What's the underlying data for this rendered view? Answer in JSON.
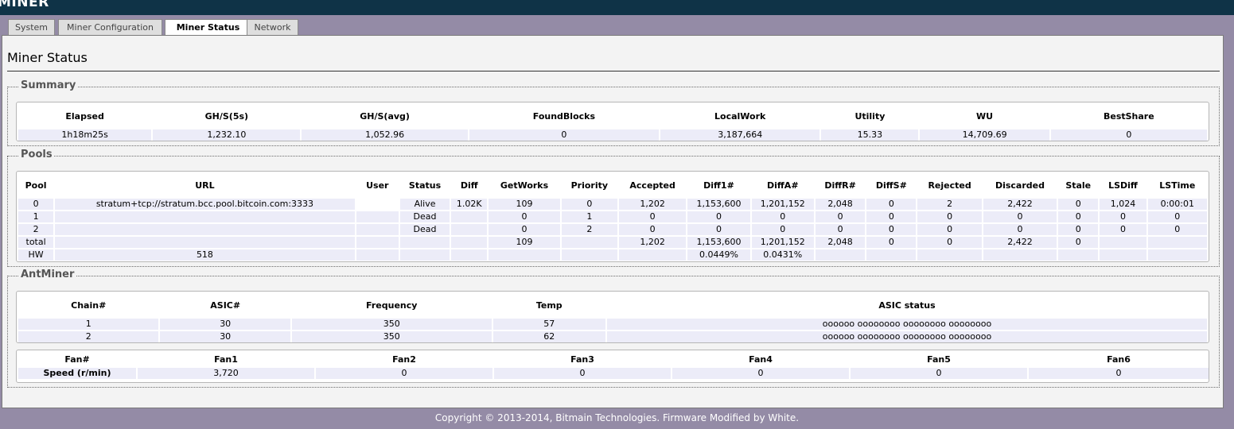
{
  "app": {
    "brand": "MINER"
  },
  "tabs": [
    {
      "label": "System"
    },
    {
      "label": "Miner Configuration"
    },
    {
      "label": "Miner Status",
      "active": true
    },
    {
      "label": "Network"
    }
  ],
  "page_title": "Miner Status",
  "summary": {
    "legend": "Summary",
    "headers": [
      "Elapsed",
      "GH/S(5s)",
      "GH/S(avg)",
      "FoundBlocks",
      "LocalWork",
      "Utility",
      "WU",
      "BestShare"
    ],
    "row": [
      "1h18m25s",
      "1,232.10",
      "1,052.96",
      "0",
      "3,187,664",
      "15.33",
      "14,709.69",
      "0"
    ]
  },
  "pools": {
    "legend": "Pools",
    "headers": [
      "Pool",
      "URL",
      "User",
      "Status",
      "Diff",
      "GetWorks",
      "Priority",
      "Accepted",
      "Diff1#",
      "DiffA#",
      "DiffR#",
      "DiffS#",
      "Rejected",
      "Discarded",
      "Stale",
      "LSDiff",
      "LSTime"
    ],
    "rows": [
      [
        "0",
        "stratum+tcp://stratum.bcc.pool.bitcoin.com:3333",
        "",
        "Alive",
        "1.02K",
        "109",
        "0",
        "1,202",
        "1,153,600",
        "1,201,152",
        "2,048",
        "0",
        "2",
        "2,422",
        "0",
        "1,024",
        "0:00:01"
      ],
      [
        "1",
        "",
        "",
        "Dead",
        "",
        "0",
        "1",
        "0",
        "0",
        "0",
        "0",
        "0",
        "0",
        "0",
        "0",
        "0",
        "0"
      ],
      [
        "2",
        "",
        "",
        "Dead",
        "",
        "0",
        "2",
        "0",
        "0",
        "0",
        "0",
        "0",
        "0",
        "0",
        "0",
        "0",
        "0"
      ],
      [
        "total",
        "",
        "",
        "",
        "",
        "109",
        "",
        "1,202",
        "1,153,600",
        "1,201,152",
        "2,048",
        "0",
        "0",
        "2,422",
        "0",
        "",
        ""
      ],
      [
        "HW",
        "518",
        "",
        "",
        "",
        "",
        "",
        "",
        "0.0449%",
        "0.0431%",
        "",
        "",
        "",
        "",
        "",
        "",
        ""
      ]
    ]
  },
  "antminer": {
    "legend": "AntMiner",
    "chain_headers": [
      "Chain#",
      "ASIC#",
      "Frequency",
      "Temp",
      "ASIC status"
    ],
    "chain_rows": [
      [
        "1",
        "30",
        "350",
        "57",
        "oooooo oooooooo oooooooo oooooooo"
      ],
      [
        "2",
        "30",
        "350",
        "62",
        "oooooo oooooooo oooooooo oooooooo"
      ]
    ],
    "fan_headers": [
      "Fan#",
      "Fan1",
      "Fan2",
      "Fan3",
      "Fan4",
      "Fan5",
      "Fan6"
    ],
    "fan_row": [
      "Speed (r/min)",
      "3,720",
      "0",
      "0",
      "0",
      "0",
      "0"
    ]
  },
  "footer": "Copyright © 2013-2014, Bitmain Technologies. Firmware Modified by White."
}
